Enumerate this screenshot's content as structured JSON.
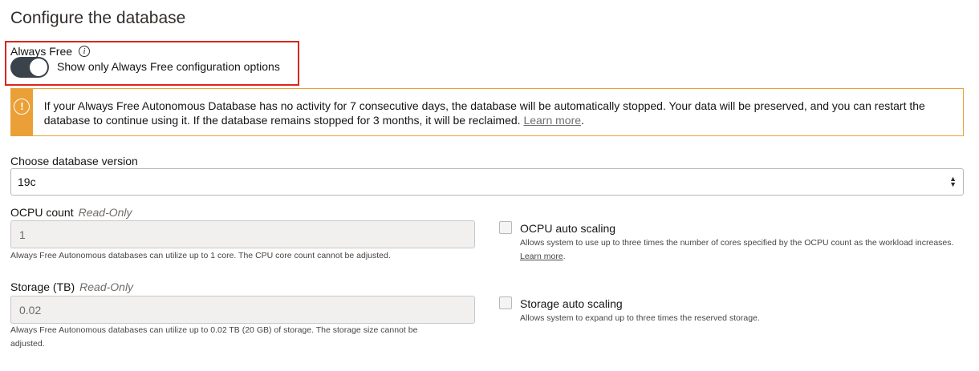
{
  "page": {
    "title": "Configure the database"
  },
  "always_free": {
    "label": "Always Free",
    "info_icon": "info-icon",
    "toggle_on": true,
    "toggle_text": "Show only Always Free configuration options"
  },
  "warning": {
    "icon": "warning-exclamation-icon",
    "text": "If your Always Free Autonomous Database has no activity for 7 consecutive days, the database will be automatically stopped. Your data will be preserved, and you can restart the database to continue using it. If the database remains stopped for 3 months, it will be reclaimed.",
    "link": "Learn more",
    "link_suffix": ".",
    "color": "#eaa037"
  },
  "version": {
    "label": "Choose database version",
    "value": "19c"
  },
  "ocpu": {
    "label": "OCPU count",
    "readonly": "Read-Only",
    "value": "1",
    "help": "Always Free Autonomous databases can utilize up to 1 core. The CPU core count cannot be adjusted.",
    "autoscale_label": "OCPU auto scaling",
    "autoscale_help": "Allows system to use up to three times the number of cores specified by the OCPU count as the workload increases.",
    "autoscale_link": "Learn more",
    "autoscale_link_suffix": "."
  },
  "storage": {
    "label": "Storage (TB)",
    "readonly": "Read-Only",
    "value": "0.02",
    "help_line1": "Always Free Autonomous databases can utilize up to 0.02 TB (20 GB) of storage. The storage size cannot be",
    "help_line2": "adjusted.",
    "autoscale_label": "Storage auto scaling",
    "autoscale_help": "Allows system to expand up to three times the reserved storage."
  }
}
